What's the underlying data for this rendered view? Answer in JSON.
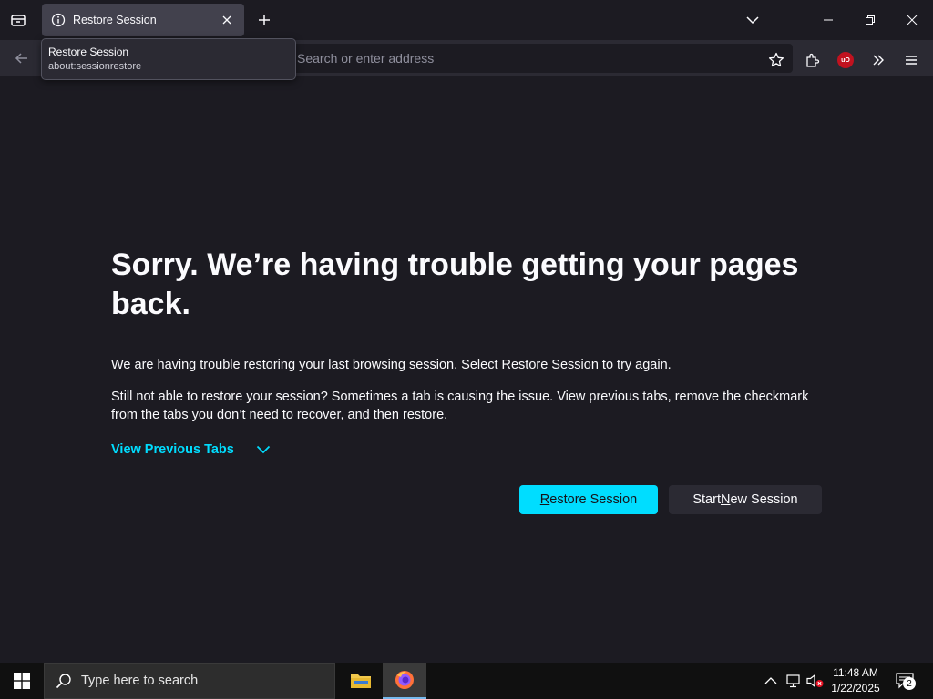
{
  "browser": {
    "tab": {
      "title": "Restore Session"
    },
    "tooltip": {
      "title": "Restore Session",
      "url": "about:sessionrestore"
    },
    "urlbar": {
      "placeholder": "Search or enter address"
    }
  },
  "page": {
    "headline": "Sorry. We’re having trouble getting your pages back.",
    "paragraph1": "We are having trouble restoring your last browsing session. Select Restore Session to try again.",
    "paragraph2": "Still not able to restore your session? Sometimes a tab is causing the issue. View previous tabs, remove the checkmark from the tabs you don’t need to recover, and then restore.",
    "view_previous_tabs": "View Previous Tabs",
    "restore_button": {
      "prefix": "",
      "accel": "R",
      "suffix": "estore Session"
    },
    "new_session_button": {
      "prefix": "Start ",
      "accel": "N",
      "suffix": "ew Session"
    }
  },
  "taskbar": {
    "search_placeholder": "Type here to search",
    "time": "11:48 AM",
    "date": "1/22/2025",
    "notification_count": "2"
  },
  "colors": {
    "accent": "#00ddff",
    "background": "#1c1b22",
    "toolbar": "#2b2a33"
  }
}
